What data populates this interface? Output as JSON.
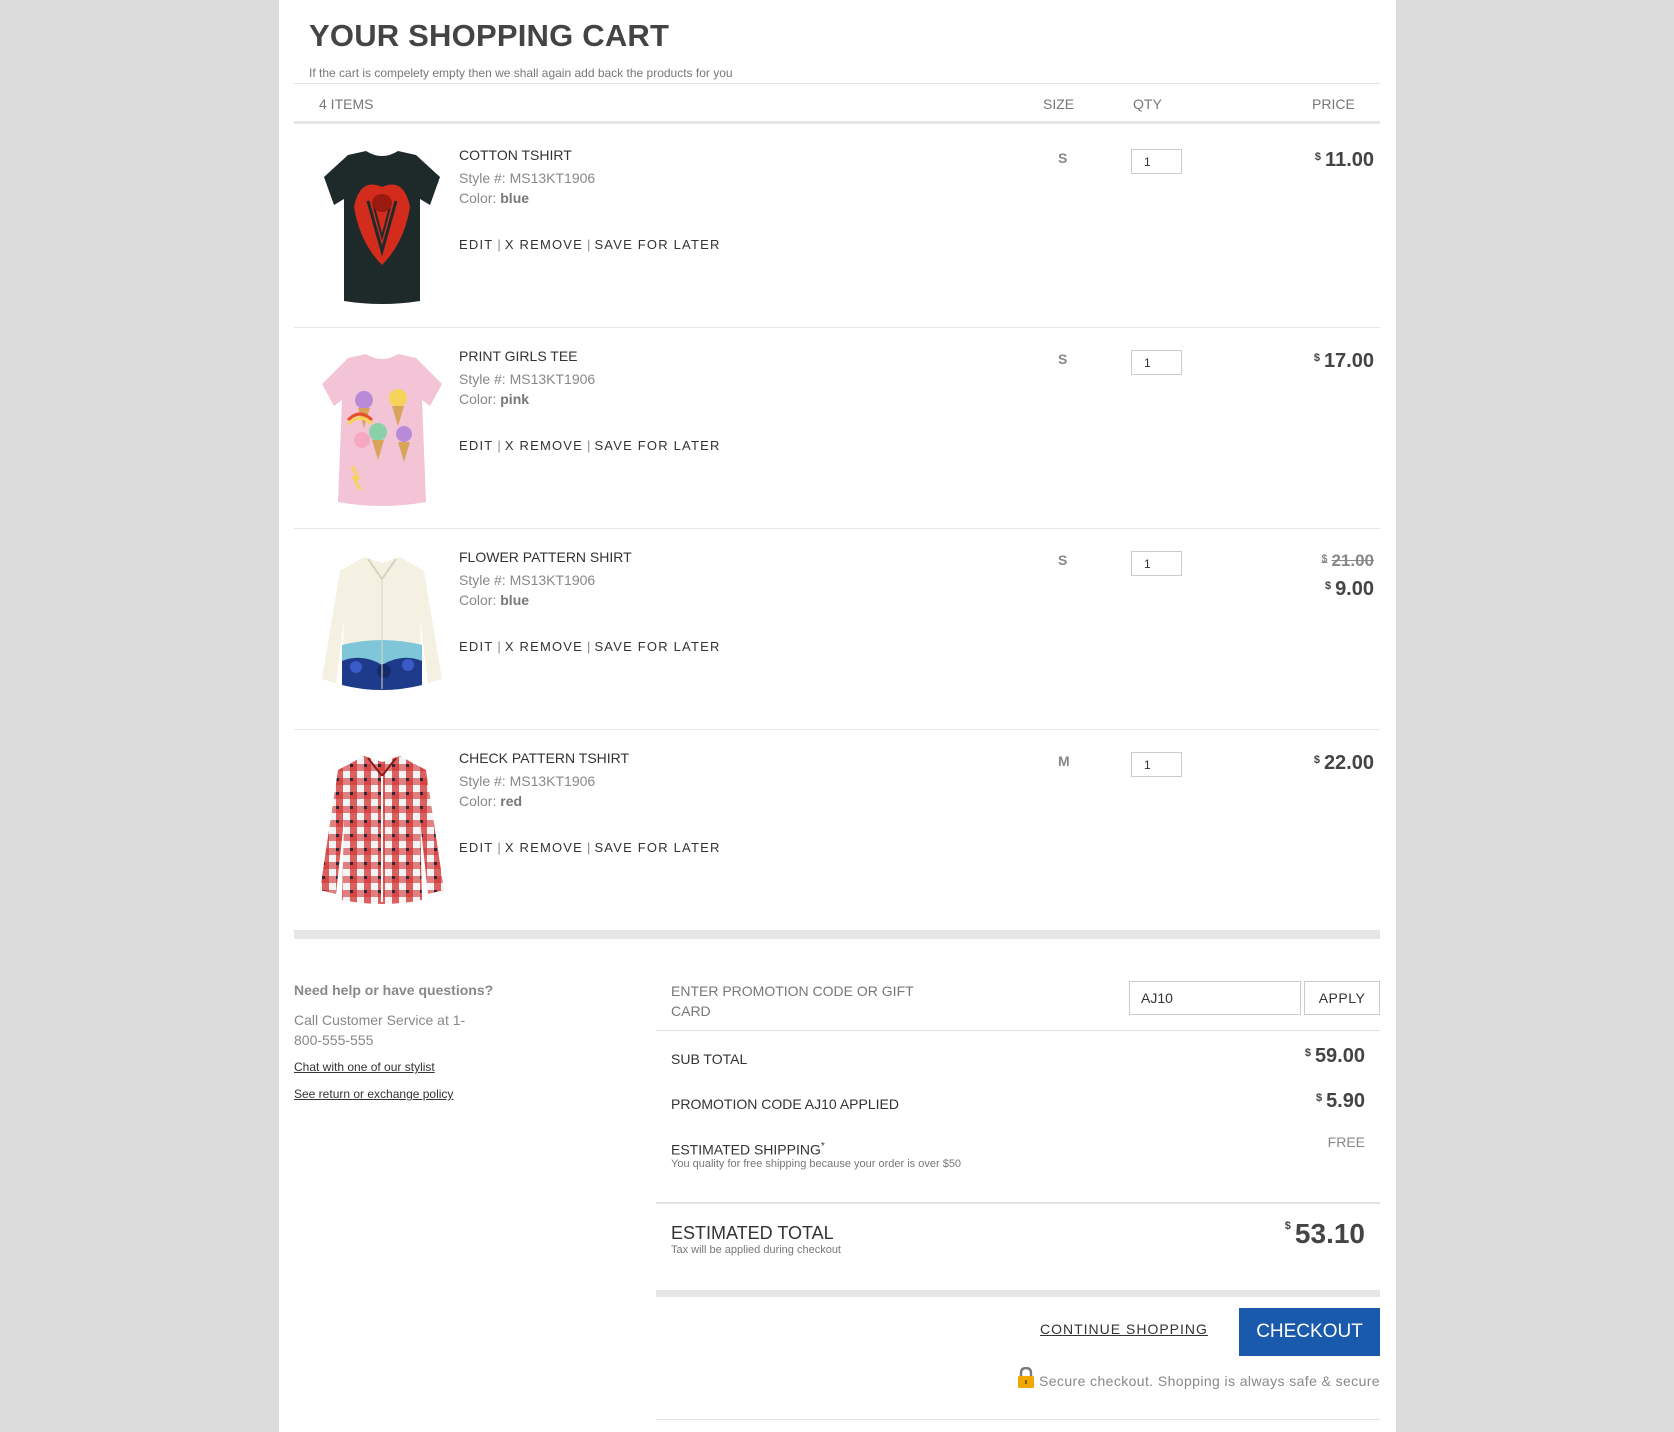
{
  "page": {
    "title": "YOUR SHOPPING CART",
    "subtitle": "If the cart is compelety empty then we shall again add back the products for you"
  },
  "table": {
    "items_count": "4 ITEMS",
    "col_size": "SIZE",
    "col_qty": "QTY",
    "col_price": "PRICE"
  },
  "actions": {
    "edit": "EDIT",
    "remove": "X REMOVE",
    "save": "SAVE FOR LATER",
    "separator": "|"
  },
  "currency": "$",
  "products": [
    {
      "name": "COTTON TSHIRT",
      "style_label": "Style #:",
      "style": "MS13KT1906",
      "color_label": "Color:",
      "color": "blue",
      "size": "S",
      "qty": "1",
      "price": "11.00"
    },
    {
      "name": "PRINT GIRLS TEE",
      "style_label": "Style #:",
      "style": "MS13KT1906",
      "color_label": "Color:",
      "color": "pink",
      "size": "S",
      "qty": "1",
      "price": "17.00"
    },
    {
      "name": "FLOWER PATTERN SHIRT",
      "style_label": "Style #:",
      "style": "MS13KT1906",
      "color_label": "Color:",
      "color": "blue",
      "size": "S",
      "qty": "1",
      "original_price": "21.00",
      "price": "9.00"
    },
    {
      "name": "CHECK PATTERN TSHIRT",
      "style_label": "Style #:",
      "style": "MS13KT1906",
      "color_label": "Color:",
      "color": "red",
      "size": "M",
      "qty": "1",
      "price": "22.00"
    }
  ],
  "help": {
    "heading": "Need help or have questions?",
    "text": "Call Customer Service at 1-800-555-555",
    "link_chat": "Chat with one of our stylist",
    "link_policy": "See return or exchange policy"
  },
  "promo": {
    "label": "ENTER PROMOTION CODE OR GIFT CARD",
    "value": "AJ10",
    "apply": "APPLY"
  },
  "summary": {
    "subtotal_label": "SUB TOTAL",
    "subtotal": "59.00",
    "promo_label": "PROMOTION CODE AJ10 APPLIED",
    "promo_value": "5.90",
    "shipping_label": "ESTIMATED SHIPPING",
    "shipping_mark": "*",
    "shipping_note": "You quality for free shipping because your order is over $50",
    "shipping_value": "FREE",
    "total_label": "ESTIMATED TOTAL",
    "total_note": "Tax will be applied during checkout",
    "total": "53.10"
  },
  "footer": {
    "continue": "CONTINUE SHOPPING",
    "checkout": "CHECKOUT",
    "secure": "Secure checkout. Shopping is always safe & secure"
  },
  "colors": {
    "checkout_bg": "#1a5aad",
    "background": "#dcdcdc",
    "lock": "#f0a800"
  },
  "icons": {
    "lock": "lock-icon"
  }
}
